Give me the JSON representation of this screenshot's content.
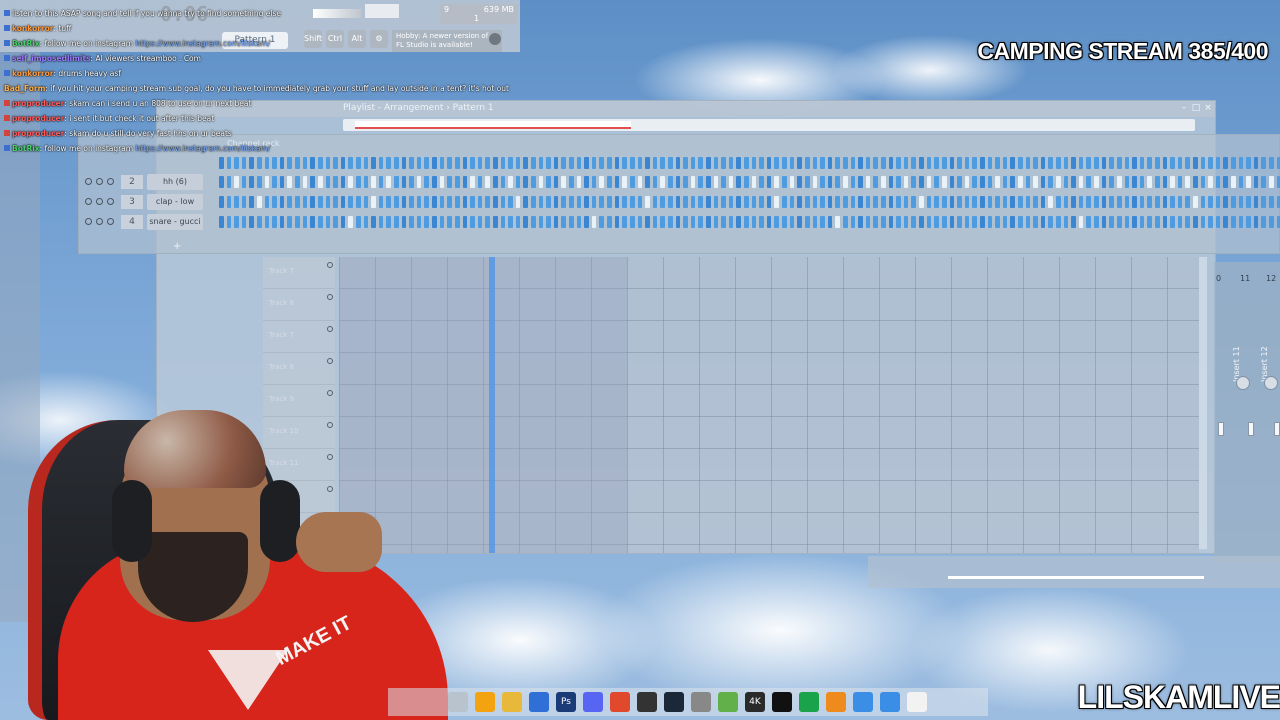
{
  "topbar": {
    "time": "0:06",
    "memory": "639 MB",
    "cpu_top": "9",
    "cpu_bottom": "1",
    "pattern_label": "Pattern 1",
    "tool_buttons": [
      "Shift",
      "Ctrl",
      "Alt"
    ],
    "hint_text": "Hobby: A newer version of FL Studio is available!"
  },
  "stream": {
    "title": "CAMPING STREAM 385/400",
    "watermark": "LILSKAMLIVE"
  },
  "chat": [
    {
      "user": "",
      "text": "listen to this ASAP song and tell if you wanna try to find something else",
      "user_color": "#9ecbff",
      "badge": "b"
    },
    {
      "user": "konkorror",
      "text": ": tuff",
      "user_color": "#ff9a3d",
      "badge": "b"
    },
    {
      "user": "BotRix",
      "text": ": follow me on instagram",
      "link": "https://www.instagram.com/lilskam/",
      "user_color": "#48d16a",
      "badge": "b"
    },
    {
      "user": "self_imposedlimits",
      "text": ": AI viewers streamboo . Com",
      "user_color": "#9f7bff",
      "badge": "b"
    },
    {
      "user": "konkorror",
      "text": ": drums heavy asf",
      "user_color": "#ff9a3d",
      "badge": "b"
    },
    {
      "user": "Bad_Form",
      "text": ": if you hit your camping stream sub goal, do you have to immediately grab your stuff and lay outside in a tent? it's hot out",
      "user_color": "#ffb04a",
      "badge": "",
      "wrap": true
    },
    {
      "user": "proproducer",
      "text": ": skam can i send u an 808 to use on ur next beat",
      "user_color": "#ff5a5a",
      "badge": "r"
    },
    {
      "user": "proproducer",
      "text": ": i sent it but check it out after this beat",
      "user_color": "#ff5a5a",
      "badge": "r"
    },
    {
      "user": "proproducer",
      "text": ": skam do u still do very fast hhs on ur beats",
      "user_color": "#ff5a5a",
      "badge": "r"
    },
    {
      "user": "BotRix",
      "text": ": follow me on instagram",
      "link": "https://www.instagram.com/lilskam/",
      "user_color": "#48d16a",
      "badge": "b"
    }
  ],
  "playlist": {
    "title": "Playlist - Arrangement › Pattern 1",
    "tracks": [
      "Track 7",
      "Track 8",
      "Track 7",
      "Track 8",
      "Track 9",
      "Track 10",
      "Track 11",
      ""
    ]
  },
  "channel_rack": {
    "title": "Channel rack",
    "channels": [
      {
        "num": "2",
        "name": "hh (6) strange"
      },
      {
        "num": "3",
        "name": "clap - low"
      },
      {
        "num": "4",
        "name": "snare - gucci"
      }
    ],
    "add_label": "+"
  },
  "mixer": {
    "labels": [
      "0",
      "11",
      "12"
    ],
    "inserts": [
      "Insert 11",
      "Insert 12"
    ]
  },
  "taskbar": {
    "icons": [
      "search-icon",
      "chrome-icon",
      "folder-icon",
      "store-icon",
      "photoshop-icon",
      "discord-icon",
      "brave-icon",
      "obs-icon",
      "steam-icon",
      "app-icon",
      "minecraft-icon",
      "4k-icon",
      "capcut-icon",
      "xbox-icon",
      "flstudio-icon",
      "notepad-icon",
      "explorer-icon",
      "file-icon"
    ],
    "labels": [
      "",
      "",
      "",
      "",
      "Ps",
      "",
      "",
      "",
      "",
      "",
      "",
      "4K",
      "",
      "",
      "",
      "",
      "",
      ""
    ],
    "colors": [
      "#b9c3cd",
      "#f2a30f",
      "#e7b83a",
      "#2f6fd6",
      "#1b3a78",
      "#5865f2",
      "#e0492b",
      "#333333",
      "#1b2838",
      "#888888",
      "#62b04a",
      "#2a2a2a",
      "#111111",
      "#1aa34a",
      "#ef8a1c",
      "#3a8ee6",
      "#3a8ee6",
      "#f2f2f2"
    ]
  }
}
